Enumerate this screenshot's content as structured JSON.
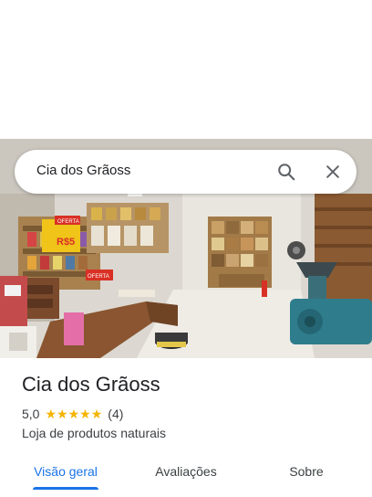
{
  "search": {
    "query": "Cia dos Grãoss",
    "search_icon": "search-icon",
    "close_icon": "close-icon"
  },
  "photo": {
    "subject": "store-interior-photo",
    "sign_offer_1": "OFERTA",
    "sign_offer_2": "OFERTA",
    "sign_price": "R$5",
    "sign_small_price": "R$"
  },
  "place": {
    "name": "Cia dos Grãoss",
    "rating": "5,0",
    "stars": 5,
    "review_count": "(4)",
    "category": "Loja de produtos naturais"
  },
  "tabs": [
    {
      "label": "Visão geral",
      "active": true
    },
    {
      "label": "Avaliações",
      "active": false
    },
    {
      "label": "Sobre",
      "active": false
    }
  ],
  "colors": {
    "accent": "#1a73e8",
    "star": "#f4b400",
    "text": "#202124",
    "secondary_text": "#3c4043"
  }
}
